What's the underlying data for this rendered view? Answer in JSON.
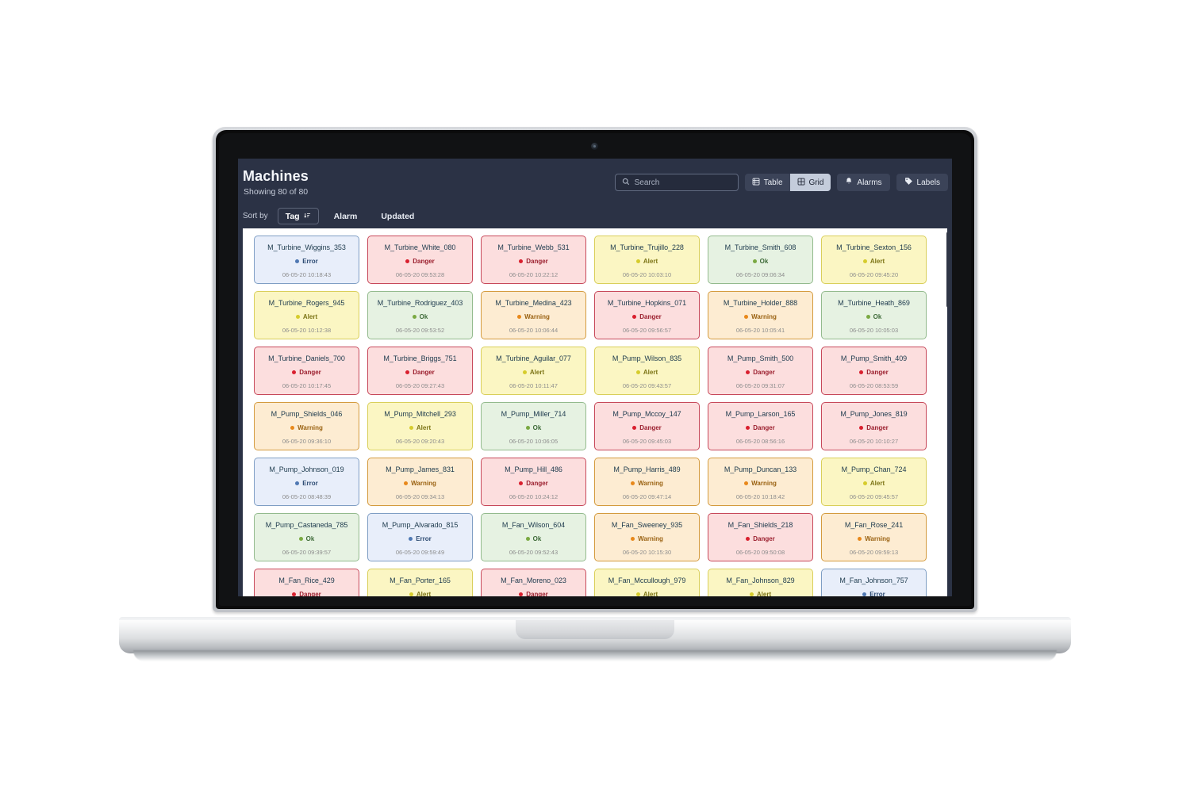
{
  "header": {
    "title": "Machines",
    "subtitle": "Showing 80 of 80"
  },
  "search": {
    "placeholder": "Search",
    "value": "",
    "icon": "search-icon"
  },
  "view_buttons": [
    {
      "label": "Table",
      "icon": "table-icon",
      "active": false
    },
    {
      "label": "Grid",
      "icon": "grid-icon",
      "active": true
    }
  ],
  "action_buttons": [
    {
      "label": "Alarms",
      "icon": "bell-icon"
    },
    {
      "label": "Labels",
      "icon": "tag-icon"
    }
  ],
  "sort": {
    "label": "Sort by",
    "active": "Tag",
    "active_icon": "sort-desc-icon",
    "options": [
      "Tag",
      "Alarm",
      "Updated"
    ]
  },
  "colors": {
    "app_header_bg": "#2b3245",
    "board_bg": "#ffffff",
    "status_error": "#4f78b3",
    "status_danger": "#d91f2e",
    "status_alert": "#d6cc2c",
    "status_ok": "#7aa942",
    "status_warning": "#e8881a"
  },
  "cards": [
    {
      "tag": "M_Turbine_Wiggins_353",
      "status": "Error",
      "updated": "06-05-20 10:18:43"
    },
    {
      "tag": "M_Turbine_White_080",
      "status": "Danger",
      "updated": "06-05-20 09:53:28"
    },
    {
      "tag": "M_Turbine_Webb_531",
      "status": "Danger",
      "updated": "06-05-20 10:22:12"
    },
    {
      "tag": "M_Turbine_Trujillo_228",
      "status": "Alert",
      "updated": "06-05-20 10:03:10"
    },
    {
      "tag": "M_Turbine_Smith_608",
      "status": "Ok",
      "updated": "06-05-20 09:06:34"
    },
    {
      "tag": "M_Turbine_Sexton_156",
      "status": "Alert",
      "updated": "06-05-20 09:45:20"
    },
    {
      "tag": "M_Turbine_Rogers_945",
      "status": "Alert",
      "updated": "06-05-20 10:12:38"
    },
    {
      "tag": "M_Turbine_Rodriguez_403",
      "status": "Ok",
      "updated": "06-05-20 09:53:52"
    },
    {
      "tag": "M_Turbine_Medina_423",
      "status": "Warning",
      "updated": "06-05-20 10:06:44"
    },
    {
      "tag": "M_Turbine_Hopkins_071",
      "status": "Danger",
      "updated": "06-05-20 09:56:57"
    },
    {
      "tag": "M_Turbine_Holder_888",
      "status": "Warning",
      "updated": "06-05-20 10:05:41"
    },
    {
      "tag": "M_Turbine_Heath_869",
      "status": "Ok",
      "updated": "06-05-20 10:05:03"
    },
    {
      "tag": "M_Turbine_Daniels_700",
      "status": "Danger",
      "updated": "06-05-20 10:17:45"
    },
    {
      "tag": "M_Turbine_Briggs_751",
      "status": "Danger",
      "updated": "06-05-20 09:27:43"
    },
    {
      "tag": "M_Turbine_Aguilar_077",
      "status": "Alert",
      "updated": "06-05-20 10:11:47"
    },
    {
      "tag": "M_Pump_Wilson_835",
      "status": "Alert",
      "updated": "06-05-20 09:43:57"
    },
    {
      "tag": "M_Pump_Smith_500",
      "status": "Danger",
      "updated": "06-05-20 09:31:07"
    },
    {
      "tag": "M_Pump_Smith_409",
      "status": "Danger",
      "updated": "06-05-20 08:53:59"
    },
    {
      "tag": "M_Pump_Shields_046",
      "status": "Warning",
      "updated": "06-05-20 09:36:10"
    },
    {
      "tag": "M_Pump_Mitchell_293",
      "status": "Alert",
      "updated": "06-05-20 09:20:43"
    },
    {
      "tag": "M_Pump_Miller_714",
      "status": "Ok",
      "updated": "06-05-20 10:06:05"
    },
    {
      "tag": "M_Pump_Mccoy_147",
      "status": "Danger",
      "updated": "06-05-20 09:45:03"
    },
    {
      "tag": "M_Pump_Larson_165",
      "status": "Danger",
      "updated": "06-05-20 08:56:16"
    },
    {
      "tag": "M_Pump_Jones_819",
      "status": "Danger",
      "updated": "06-05-20 10:10:27"
    },
    {
      "tag": "M_Pump_Johnson_019",
      "status": "Error",
      "updated": "06-05-20 08:48:39"
    },
    {
      "tag": "M_Pump_James_831",
      "status": "Warning",
      "updated": "06-05-20 09:34:13"
    },
    {
      "tag": "M_Pump_Hill_486",
      "status": "Danger",
      "updated": "06-05-20 10:24:12"
    },
    {
      "tag": "M_Pump_Harris_489",
      "status": "Warning",
      "updated": "06-05-20 09:47:14"
    },
    {
      "tag": "M_Pump_Duncan_133",
      "status": "Warning",
      "updated": "06-05-20 10:18:42"
    },
    {
      "tag": "M_Pump_Chan_724",
      "status": "Alert",
      "updated": "06-05-20 09:45:57"
    },
    {
      "tag": "M_Pump_Castaneda_785",
      "status": "Ok",
      "updated": "06-05-20 09:39:57"
    },
    {
      "tag": "M_Pump_Alvarado_815",
      "status": "Error",
      "updated": "06-05-20 09:59:49"
    },
    {
      "tag": "M_Fan_Wilson_604",
      "status": "Ok",
      "updated": "06-05-20 09:52:43"
    },
    {
      "tag": "M_Fan_Sweeney_935",
      "status": "Warning",
      "updated": "06-05-20 10:15:30"
    },
    {
      "tag": "M_Fan_Shields_218",
      "status": "Danger",
      "updated": "06-05-20 09:50:08"
    },
    {
      "tag": "M_Fan_Rose_241",
      "status": "Warning",
      "updated": "06-05-20 09:59:13"
    },
    {
      "tag": "M_Fan_Rice_429",
      "status": "Danger",
      "updated": ""
    },
    {
      "tag": "M_Fan_Porter_165",
      "status": "Alert",
      "updated": ""
    },
    {
      "tag": "M_Fan_Moreno_023",
      "status": "Danger",
      "updated": ""
    },
    {
      "tag": "M_Fan_Mccullough_979",
      "status": "Alert",
      "updated": ""
    },
    {
      "tag": "M_Fan_Johnson_829",
      "status": "Alert",
      "updated": ""
    },
    {
      "tag": "M_Fan_Johnson_757",
      "status": "Error",
      "updated": ""
    }
  ]
}
